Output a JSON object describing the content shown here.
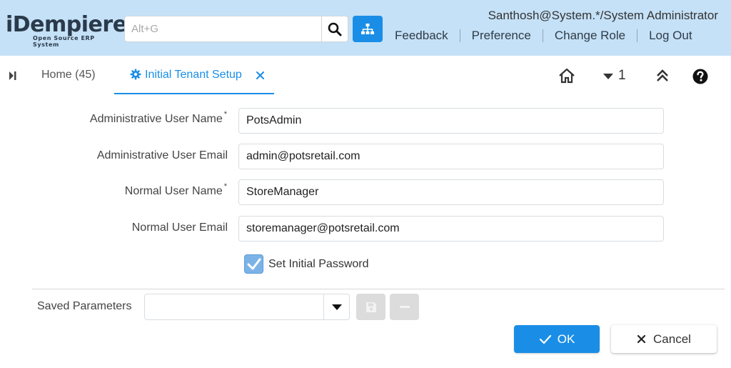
{
  "header": {
    "logo_main": "iDempiere",
    "logo_sub": "Open Source ERP System",
    "search_placeholder": "Alt+G",
    "user": "Santhosh@System.*/System Administrator",
    "links": [
      "Feedback",
      "Preference",
      "Change Role",
      "Log Out"
    ]
  },
  "tabs": {
    "home": "Home (45)",
    "active": "Initial Tenant Setup"
  },
  "toolbar": {
    "nav_count": "1"
  },
  "form": {
    "admin_user_name_label": "Administrative User Name",
    "admin_user_name_value": "PotsAdmin",
    "admin_email_label": "Administrative User Email",
    "admin_email_value": "admin@potsretail.com",
    "normal_user_name_label": "Normal User Name",
    "normal_user_name_value": "StoreManager",
    "normal_email_label": "Normal User Email",
    "normal_email_value": "storemanager@potsretail.com",
    "required_marker": "*",
    "set_password_label": "Set Initial Password",
    "set_password_checked": true
  },
  "footer": {
    "saved_params_label": "Saved Parameters",
    "saved_params_value": "",
    "ok_label": "OK",
    "cancel_label": "Cancel"
  },
  "colors": {
    "header_bg": "#c5e1f7",
    "accent": "#1a8ee6",
    "checkbox": "#7cb3e6"
  }
}
